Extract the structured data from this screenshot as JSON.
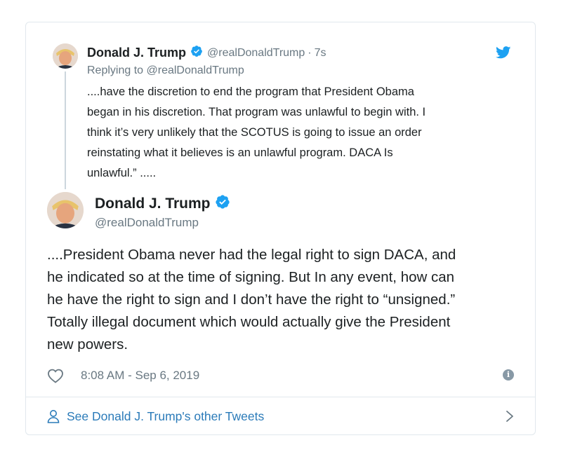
{
  "parent_tweet": {
    "name": "Donald J. Trump",
    "handle": "@realDonaldTrump",
    "separator": "·",
    "time": "7s",
    "replying_to": "Replying to @realDonaldTrump",
    "text": "....have the discretion to end the program that President Obama\nbegan in his discretion. That program was unlawful to begin with. I\nthink it’s very unlikely that the SCOTUS is going to issue an order\nreinstating what it believes is an unlawful program. DACA Is\nunlawful.” .....",
    "avatar_icon": "user-avatar-icon",
    "verified_icon": "verified-badge-icon"
  },
  "main_tweet": {
    "name": "Donald J. Trump",
    "handle": "@realDonaldTrump",
    "text": "....President Obama never had the legal right to sign DACA, and\nhe indicated so at the time of signing. But In any event, how can\nhe have the right to sign and I don’t have the right to “unsigned.”\nTotally illegal document which would actually give the President\nnew powers.",
    "timestamp": "8:08 AM - Sep 6, 2019",
    "like_icon": "heart-icon",
    "info_icon": "info-icon"
  },
  "footer": {
    "link_text": "See Donald J. Trump's other Tweets",
    "person_icon": "person-icon",
    "chevron_icon": "chevron-right-icon"
  },
  "colors": {
    "twitter_blue": "#1da1f2",
    "link_blue": "#2b7bb9",
    "text_primary": "#1c2022",
    "text_secondary": "#697882",
    "border": "#e1e8ed",
    "info_grey": "#8899a6"
  }
}
